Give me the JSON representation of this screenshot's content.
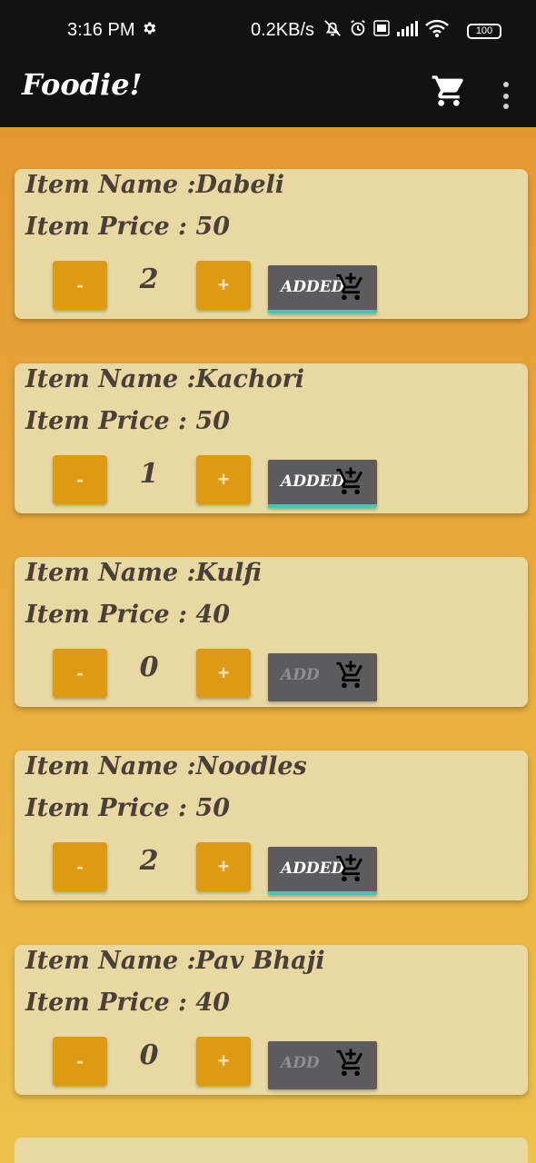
{
  "status": {
    "time": "3:16 PM",
    "speed": "0.2KB/s",
    "battery": "100"
  },
  "app": {
    "title": "Foodie!",
    "icons": [
      "cart-icon",
      "more-vert-icon"
    ]
  },
  "items": [
    {
      "name_line": "Item Name :Dabeli",
      "price_line": "Item Price : 50",
      "minus": "-",
      "plus": "+",
      "qty": "2",
      "button": "ADDED"
    },
    {
      "name_line": "Item Name :Kachori",
      "price_line": "Item Price : 50",
      "minus": "-",
      "plus": "+",
      "qty": "1",
      "button": "ADDED"
    },
    {
      "name_line": "Item Name :Kulfi",
      "price_line": "Item Price : 40",
      "minus": "-",
      "plus": "+",
      "qty": "0",
      "button": "ADD"
    },
    {
      "name_line": "Item Name :Noodles",
      "price_line": "Item Price : 50",
      "minus": "-",
      "plus": "+",
      "qty": "2",
      "button": "ADDED"
    },
    {
      "name_line": "Item Name :Pav Bhaji",
      "price_line": "Item Price : 40",
      "minus": "-",
      "plus": "+",
      "qty": "0",
      "button": "ADD"
    }
  ],
  "colors": {
    "app_bar": "#121212",
    "card": "#e8d8a2",
    "qty_button": "#df9a14",
    "add_button": "#5c5b5d",
    "added_underline": "#3fc7b7"
  }
}
